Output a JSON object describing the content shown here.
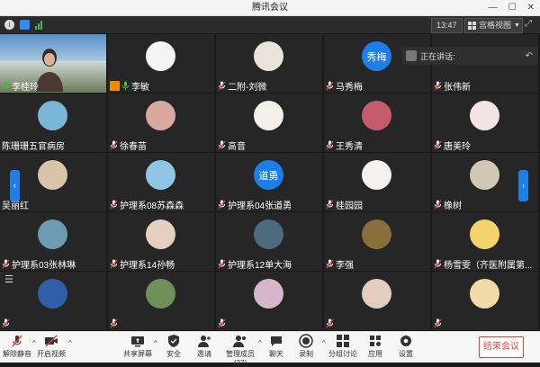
{
  "window": {
    "title": "腾讯会议"
  },
  "infobar": {
    "clock": "13:47",
    "view_label": "宫格视图"
  },
  "speaking": {
    "label": "正在讲话:"
  },
  "tiles": [
    {
      "name": "李桂玲",
      "kind": "video",
      "mic": "on"
    },
    {
      "name": "李敏",
      "kind": "avatar",
      "color": "#f4f4f4",
      "host": true,
      "mic": "on"
    },
    {
      "name": "二附-刘微",
      "kind": "avatar",
      "color": "#e9e3dc",
      "mic": "muted"
    },
    {
      "name": "马秀梅",
      "kind": "text",
      "avatar_text": "秀梅",
      "mic": "muted"
    },
    {
      "name": "张伟新",
      "kind": "none",
      "mic": "muted"
    },
    {
      "name": "陈珊珊五官病房",
      "kind": "avatar",
      "color": "#7ab6d6",
      "mic": "none"
    },
    {
      "name": "徐春苗",
      "kind": "avatar",
      "color": "#d9a9a0",
      "mic": "muted"
    },
    {
      "name": "高音",
      "kind": "avatar",
      "color": "#f3efe9",
      "mic": "muted"
    },
    {
      "name": "王秀清",
      "kind": "avatar",
      "color": "#c65b6e",
      "mic": "muted"
    },
    {
      "name": "唐美玲",
      "kind": "avatar",
      "color": "#f2e4e4",
      "mic": "muted"
    },
    {
      "name": "吴丽红",
      "kind": "avatar",
      "color": "#d8c4a8",
      "mic": "none"
    },
    {
      "name": "护理系08苏森森",
      "kind": "avatar",
      "color": "#8fc6e3",
      "mic": "muted"
    },
    {
      "name": "护理系04张道勇",
      "kind": "text",
      "avatar_text": "道勇",
      "mic": "muted"
    },
    {
      "name": "桂园园",
      "kind": "avatar",
      "color": "#f4f2ef",
      "mic": "muted"
    },
    {
      "name": "橡树",
      "kind": "avatar",
      "color": "#d0c7b4",
      "mic": "muted"
    },
    {
      "name": "护理系03张林琳",
      "kind": "avatar",
      "color": "#6e9bb4",
      "mic": "muted"
    },
    {
      "name": "护理系14孙畅",
      "kind": "avatar",
      "color": "#e7cfc0",
      "mic": "muted"
    },
    {
      "name": "护理系12单大海",
      "kind": "avatar",
      "color": "#4e6a7d",
      "mic": "muted"
    },
    {
      "name": "李强",
      "kind": "avatar",
      "color": "#8a6f3c",
      "mic": "muted"
    },
    {
      "name": "杨雪雯（齐医附属第...",
      "kind": "avatar",
      "color": "#f3d36a",
      "mic": "muted"
    },
    {
      "name": "",
      "kind": "avatar",
      "color": "#2f5fa8",
      "mic": "muted"
    },
    {
      "name": "",
      "kind": "avatar",
      "color": "#6f8f5b",
      "mic": "muted"
    },
    {
      "name": "",
      "kind": "avatar",
      "color": "#d6b6c9",
      "mic": "muted"
    },
    {
      "name": "",
      "kind": "avatar",
      "color": "#e3cdbf",
      "mic": "muted"
    },
    {
      "name": "",
      "kind": "avatar",
      "color": "#f1d9a8",
      "mic": "muted"
    }
  ],
  "toolbar": {
    "mute": "解除静音",
    "video": "开启视频",
    "share": "共享屏幕",
    "security": "安全",
    "invite": "邀请",
    "members": "管理成员(27)",
    "chat": "聊天",
    "record": "录制",
    "breakout": "分组讨论",
    "apps": "应用",
    "settings": "设置",
    "end": "结束会议"
  }
}
